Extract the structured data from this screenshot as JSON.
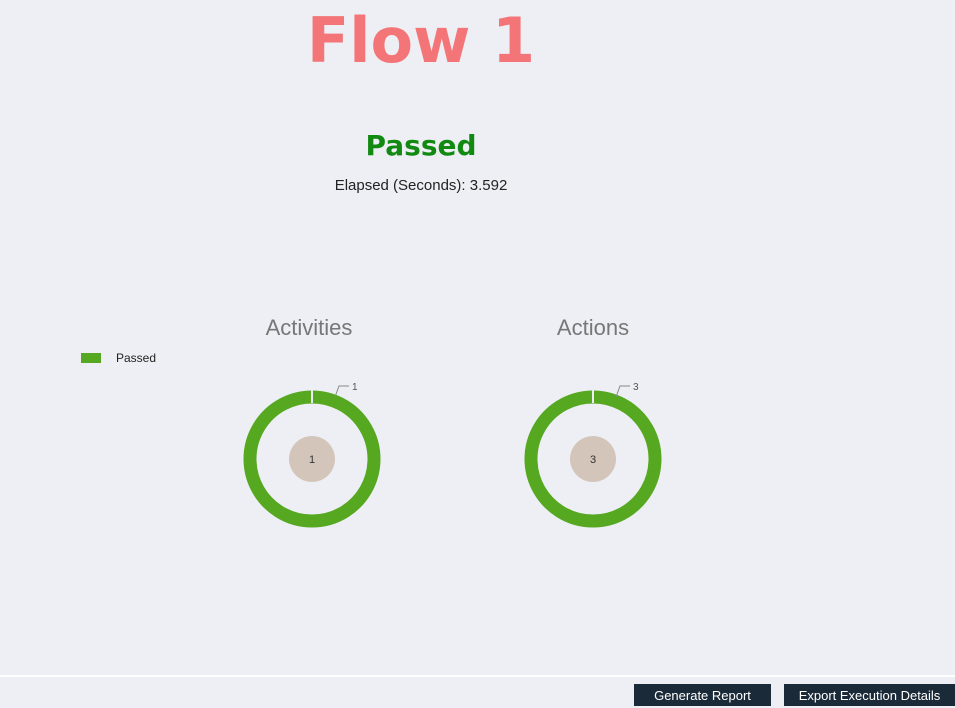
{
  "flow": {
    "title": "Flow 1",
    "title_color": "#f37577",
    "status": "Passed",
    "status_color": "#128a12",
    "elapsed_label": "Elapsed (Seconds):",
    "elapsed_value": "3.592"
  },
  "legend": {
    "label": "Passed",
    "color": "#56a821"
  },
  "charts": {
    "activities": {
      "title": "Activities",
      "passed": 1,
      "total": 1,
      "callout": "1",
      "center_label": "1"
    },
    "actions": {
      "title": "Actions",
      "passed": 3,
      "total": 3,
      "callout": "3",
      "center_label": "3"
    }
  },
  "colors": {
    "passed": "#56a821",
    "center": "#d3c5b9",
    "background": "#eeeff4",
    "button_bg": "#1b2a39"
  },
  "buttons": {
    "generate_report": "Generate Report",
    "export_execution_details": "Export Execution Details"
  }
}
